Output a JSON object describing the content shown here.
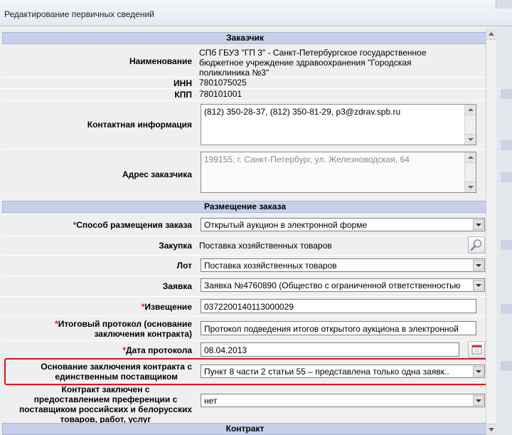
{
  "window": {
    "title": "Редактирование первичных сведений"
  },
  "sections": {
    "customer": "Заказчик",
    "placement": "Размещение заказа",
    "contract": "Контракт"
  },
  "customer": {
    "name_label": "Наименование",
    "name_lines": [
      "СПб ГБУЗ \"ГП 3\" - Санкт-Петербургское государственное",
      "бюджетное учреждение здравоохранения \"Городская",
      "поликлиника №3\""
    ],
    "inn_label": "ИНН",
    "inn_value": "7801075025",
    "kpp_label": "КПП",
    "kpp_value": "780101001",
    "contact_label": "Контактная информация",
    "contact_value": "(812) 350-28-37, (812) 350-81-29, p3@zdrav.spb.ru",
    "address_label": "Адрес заказчика",
    "address_value": "199155, г. Санкт-Петербург, ул. Железноводская, 64"
  },
  "placement": {
    "method_label": "Способ размещения заказа",
    "method_value": "Открытый аукцион в электронной форме",
    "purchase_label": "Закупка",
    "purchase_value": "Поставка  хозяйственных товаров",
    "lot_label": "Лот",
    "lot_value": "Поставка хозяйственных товаров",
    "bid_label": "Заявка",
    "bid_value": "Заявка №4760890 (Общество с ограниченной ответственностью",
    "notice_label": "Извещение",
    "notice_value": "0372200140113000029",
    "protocol_label_lines": [
      "Итоговый протокол (основание",
      "заключения контракта)"
    ],
    "protocol_value": "Протокол подведения итогов открытого аукциона в электронной",
    "protocol_date_label": "Дата протокола",
    "protocol_date_value": "08.04.2013",
    "single_supplier_label_lines": [
      "Основание заключения контракта с",
      "единственным поставщиком"
    ],
    "single_supplier_value": "Пункт 8 части 2 статьи 55 – представлена только одна заявк..",
    "preference_label_lines": [
      "Контракт заключен с",
      "предоставлением преференции с",
      "поставщиком российских и белорусских",
      "товаров, работ, услуг"
    ],
    "preference_value": "нет"
  },
  "required_mark": "*",
  "colors": {
    "section_bg": "#c7d0ea",
    "highlight": "#e0141e",
    "required": "#d41c1c"
  }
}
